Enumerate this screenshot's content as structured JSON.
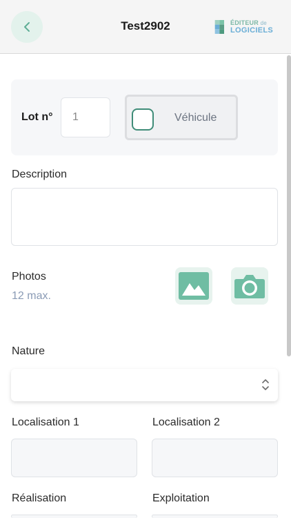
{
  "header": {
    "title": "Test2902",
    "back_icon": "chevron-left-icon",
    "logo": {
      "line1": "ÉDITEUR",
      "line1_small": "de",
      "line2": "LOGICIELS"
    }
  },
  "lot": {
    "label": "Lot n°",
    "number_value": "1",
    "vehicule_label": "Véhicule",
    "vehicule_checked": false
  },
  "description": {
    "label": "Description",
    "value": ""
  },
  "photos": {
    "label": "Photos",
    "max_text": "12 max.",
    "gallery_icon": "image-icon",
    "camera_icon": "camera-icon"
  },
  "nature": {
    "label": "Nature",
    "selected": ""
  },
  "localisation1": {
    "label": "Localisation 1",
    "value": ""
  },
  "localisation2": {
    "label": "Localisation 2",
    "value": ""
  },
  "realisation": {
    "label": "Réalisation"
  },
  "exploitation": {
    "label": "Exploitation"
  },
  "colors": {
    "accent": "#3f8c78",
    "accent_light": "#e7f3ee",
    "muted_text": "#8a9bb5"
  }
}
